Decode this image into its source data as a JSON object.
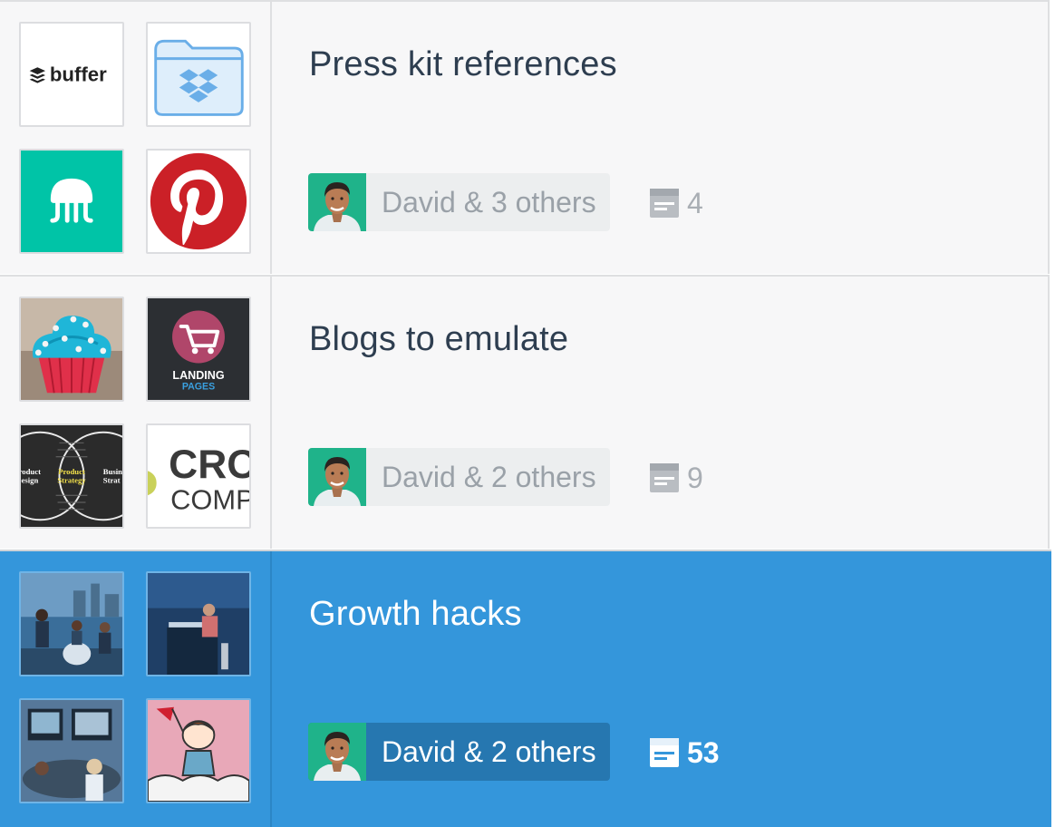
{
  "boards": [
    {
      "title": "Press kit references",
      "collaborators": "David & 3 others",
      "item_count": "4",
      "selected": false,
      "thumbnails": [
        "buffer-logo",
        "dropbox-folder-icon",
        "jellyfish-logo",
        "pinterest-logo"
      ],
      "thumbnail_text": {
        "buffer": "buffer"
      }
    },
    {
      "title": "Blogs to emulate",
      "collaborators": "David & 2 others",
      "item_count": "9",
      "selected": false,
      "thumbnails": [
        "cupcake-photo",
        "landing-pages-cart",
        "venn-diagram",
        "cro-logo"
      ],
      "thumbnail_text": {
        "landing": "LANDING",
        "pages": "PAGES",
        "venn_left_1": "Product",
        "venn_left_2": "Design",
        "venn_mid_1": "Product",
        "venn_mid_2": "Strategy",
        "venn_right_1": "Busin",
        "venn_right_2": "Strat",
        "cro_1": "CRO",
        "cro_2": "COMP"
      }
    },
    {
      "title": "Growth hacks",
      "collaborators": "David & 2 others",
      "item_count": "53",
      "selected": true,
      "thumbnails": [
        "band-photo",
        "stage-photo",
        "meeting-photo",
        "comic-illustration"
      ]
    }
  ],
  "icons": {
    "count": "notes-icon",
    "avatar": "user-avatar"
  },
  "colors": {
    "selected_bg": "#3496db",
    "row_bg": "#f7f7f8",
    "title": "#2e3e50",
    "pinterest": "#cb2027",
    "jellyfish": "#00c4a7"
  }
}
